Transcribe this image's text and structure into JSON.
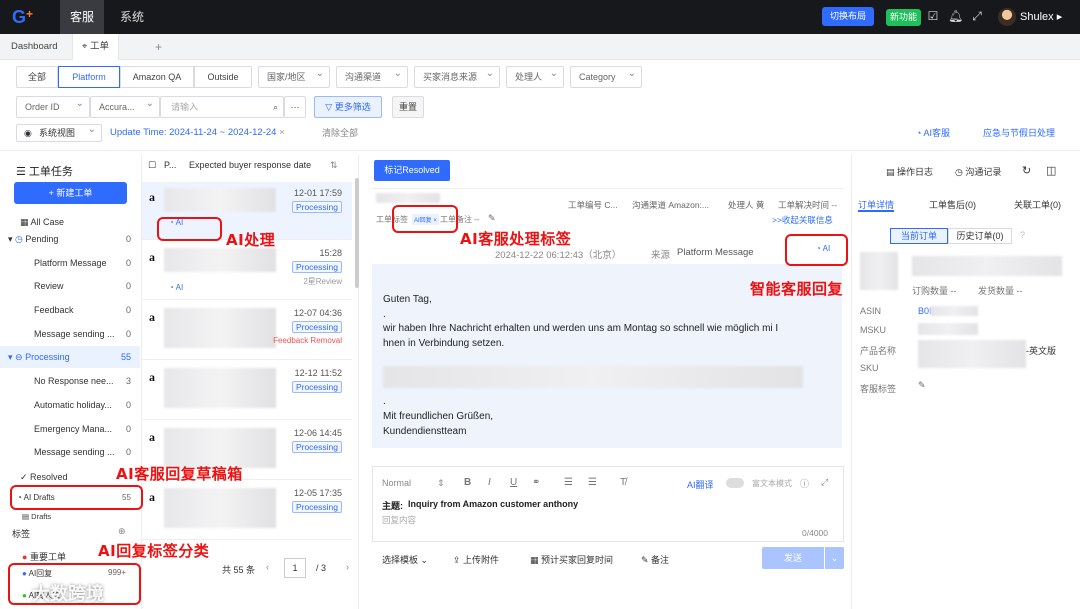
{
  "topbar": {
    "logo": "G",
    "nav": [
      "客服",
      "系统"
    ],
    "switch_layout": "切换布局",
    "new_feature": "新功能",
    "username": "Shulex"
  },
  "tabs": {
    "dashboard": "Dashboard",
    "workorder": "工单",
    "add": "+"
  },
  "filters": {
    "segments": [
      "全部",
      "Platform",
      "Amazon QA",
      "Outside"
    ],
    "dropdowns": [
      "国家/地区",
      "沟通渠道",
      "买家消息来源",
      "处理人",
      "Category"
    ],
    "order_field": "Order ID",
    "match": "Accura...",
    "input_placeholder": "请输入",
    "more": "更多筛选",
    "reset": "重置",
    "view": "系统视图",
    "date_range": "Update Time: 2024-11-24 ~ 2024-12-24",
    "clear_all": "清除全部",
    "ai_service": "AI客服",
    "holiday": "应急与节假日处理"
  },
  "left": {
    "title": "工单任务",
    "new_ticket": "+ 新建工单",
    "all_case": "All Case",
    "pending": "Pending",
    "pending_count": "0",
    "pending_items": [
      {
        "label": "Platform Message",
        "count": "0"
      },
      {
        "label": "Review",
        "count": "0"
      },
      {
        "label": "Feedback",
        "count": "0"
      },
      {
        "label": "Message sending ...",
        "count": "0"
      }
    ],
    "processing": "Processing",
    "processing_count": "55",
    "processing_items": [
      {
        "label": "No Response nee...",
        "count": "3"
      },
      {
        "label": "Automatic holiday...",
        "count": "0"
      },
      {
        "label": "Emergency Mana...",
        "count": "0"
      },
      {
        "label": "Message sending ...",
        "count": "0"
      }
    ],
    "resolved": "Resolved",
    "ai_drafts": "AI Drafts",
    "ai_drafts_count": "55",
    "drafts": "Drafts",
    "tags_title": "标签",
    "tag_important": "重要工单",
    "tag_ai_reply": "AI回复",
    "tag_ai_reply_count": "999+",
    "tag_ai_transfer": "AI转人工"
  },
  "list": {
    "header_p": "P...",
    "sort": "Expected buyer response date",
    "tickets": [
      {
        "time": "12-01 17:59",
        "status": "Processing",
        "ai": "AI",
        "extra": ""
      },
      {
        "time": "15:28",
        "status": "Processing",
        "ai": "AI",
        "extra": "2星Review"
      },
      {
        "time": "12-07 04:36",
        "status": "Processing",
        "ai": "",
        "extra": "Feedback Removal"
      },
      {
        "time": "12-12 11:52",
        "status": "Processing",
        "ai": "",
        "extra": ""
      },
      {
        "time": "12-06 14:45",
        "status": "Processing",
        "ai": "",
        "extra": ""
      },
      {
        "time": "12-05 17:35",
        "status": "Processing",
        "ai": "",
        "extra": ""
      }
    ],
    "total": "共 55 条",
    "page": "1",
    "pages": "/ 3"
  },
  "detail": {
    "resolved_btn": "标记Resolved",
    "op_log": "操作日志",
    "comm_log": "沟通记录",
    "meta": [
      "工单编号 C...",
      "沟通渠道 Amazon:...",
      "处理人 黄",
      "工单解决时间 --"
    ],
    "tag_label": "工单标签",
    "tag_chip": "AI回复 ×",
    "note_label": "工单备注 --",
    "collapse": ">>收起关联信息",
    "timestamp": "2024-12-22 06:12:43（北京）",
    "source_label": "来源",
    "source": "Platform Message",
    "ai_badge": "AI",
    "message": [
      "Guten Tag,",
      ".",
      "wir haben Ihre Nachricht erhalten und werden uns am Montag so schnell wie möglich mi I",
      "hnen in Verbindung setzen.",
      ".",
      "Mit freundlichen Grüßen,",
      "Kundendienstteam"
    ],
    "editor": {
      "format": "Normal",
      "ai_translate": "AI翻译",
      "rich_text": "富文本模式",
      "subject_label": "主题:",
      "subject": "Inquiry from Amazon customer anthony",
      "placeholder": "回复内容",
      "counter": "0/4000"
    },
    "footer": {
      "template": "选择模板",
      "upload": "上传附件",
      "schedule": "预计买家回复时间",
      "note": "备注",
      "send": "发送"
    }
  },
  "right": {
    "tabs": [
      "订单详情",
      "工单售后(0)",
      "关联工单(0)"
    ],
    "current_order": "当前订单",
    "history_order": "历史订单(0)",
    "order_qty": "订购数量 --",
    "ship_qty": "发货数量 --",
    "asin_label": "ASIN",
    "asin": "B0I",
    "msku": "MSKU",
    "product_name": "产品名称",
    "product_suffix": "-英文版",
    "sku": "SKU",
    "customer_tag": "客服标签"
  },
  "annotations": {
    "ai_process": "AI处理",
    "ai_tag": "AI客服处理标签",
    "smart_reply": "智能客服回复",
    "drafts_box": "AI客服回复草稿箱",
    "tag_category": "AI回复标签分类"
  },
  "watermark": "大数跨境",
  "colors": {
    "accent": "#2f6bff",
    "annotation": "#e11",
    "topbar": "#17181c"
  }
}
